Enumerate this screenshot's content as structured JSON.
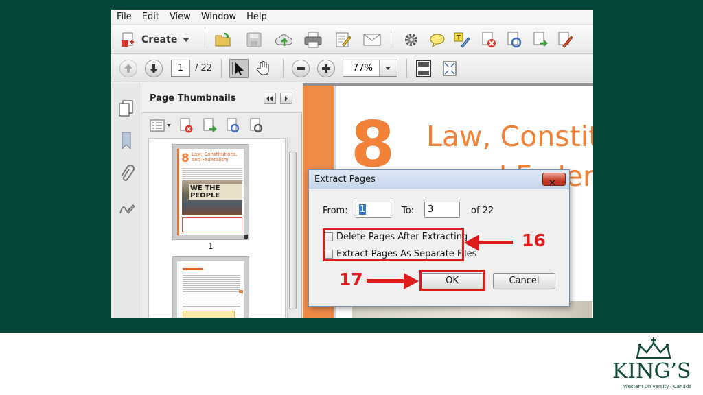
{
  "menu": [
    "File",
    "Edit",
    "View",
    "Window",
    "Help"
  ],
  "toolbar": {
    "create_label": "Create"
  },
  "navigation": {
    "current_page": "1",
    "page_total": "/ 22",
    "zoom": "77%"
  },
  "panel": {
    "title": "Page Thumbnails",
    "thumb_page_number": "1",
    "thumb_title": "Law, Constitutions, and Federalism",
    "thumb_number": "8",
    "thumb_photo_text": "WE THE PEOPLE"
  },
  "document": {
    "chapter_number": "8",
    "title_line1": "Law, Constit",
    "title_line2": "and Federal"
  },
  "dialog": {
    "title": "Extract Pages",
    "from_label": "From:",
    "from_value": "1",
    "to_label": "To:",
    "to_value": "3",
    "of_label": "of 22",
    "option_delete": "Delete Pages After Extracting",
    "option_separate": "Extract Pages As Separate Files",
    "ok_label": "OK",
    "cancel_label": "Cancel",
    "close_glyph": "✕"
  },
  "annotations": {
    "step16": "16",
    "step17": "17",
    "color": "#e01b1b"
  },
  "branding": {
    "name": "KING’S",
    "tagline": "Western University · Canada",
    "color": "#0f4a3a"
  },
  "colors": {
    "slide_background": "#05473a",
    "accent_orange": "#f08136"
  }
}
